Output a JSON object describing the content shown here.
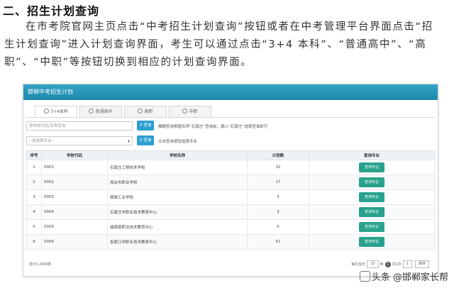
{
  "article": {
    "heading": "二、招生计划查询",
    "paragraph": "在市考院官网主页点击“中考招生计划查询”按钮或者在中考管理平台界面点击“招生计划查询”进入计划查询界面，考生可以通过点击“3+4 本科”、“普通高中”、“高职”、“中职”等按钮切换到相应的计划查询界面。"
  },
  "screenshot": {
    "header_title": "邯郸中考招生计划",
    "tabs": [
      "3+4本科",
      "普通高中",
      "高职",
      "中职"
    ],
    "search": {
      "placeholder": "按学校代码/名称查询"
    },
    "filter": {
      "value": "--请选择专业--"
    },
    "query_label": "查询",
    "hint1": "模糊查询根据名称“石家庄”查询前，输入“石家庄”选择查询即可",
    "hint2": "点击查询按钮选择专业",
    "columns": [
      "序号",
      "学校代码",
      "学校名称",
      "计划数",
      "查询专业"
    ],
    "rows": [
      {
        "no": "1",
        "code": "0001",
        "name": "石家庄工程技术学校",
        "plan": "32",
        "action": "查询专业"
      },
      {
        "no": "2",
        "code": "0002",
        "name": "邢台市职业学校",
        "plan": "17",
        "action": "查询专业"
      },
      {
        "no": "3",
        "code": "0003",
        "name": "邯郸工业学校",
        "plan": "3",
        "action": "查询专业"
      },
      {
        "no": "4",
        "code": "0004",
        "name": "石家庄市职业技术教育中心",
        "plan": "3",
        "action": "查询专业"
      },
      {
        "no": "5",
        "code": "0005",
        "name": "曲周县职业技术教育中心",
        "plan": "5",
        "action": "查询专业"
      },
      {
        "no": "6",
        "code": "0006",
        "name": "张家口市职业技术教育中心",
        "plan": "52",
        "action": "查询专业"
      }
    ],
    "footer_left": "显示1-6共6条",
    "pager": {
      "per_page_label": "每页显示",
      "per_page": "10",
      "unit": "条",
      "page": "1",
      "total": "共1页",
      "goto": "跳转",
      "go_page": "1"
    }
  },
  "watermark": "头条 @邯郸家长帮"
}
